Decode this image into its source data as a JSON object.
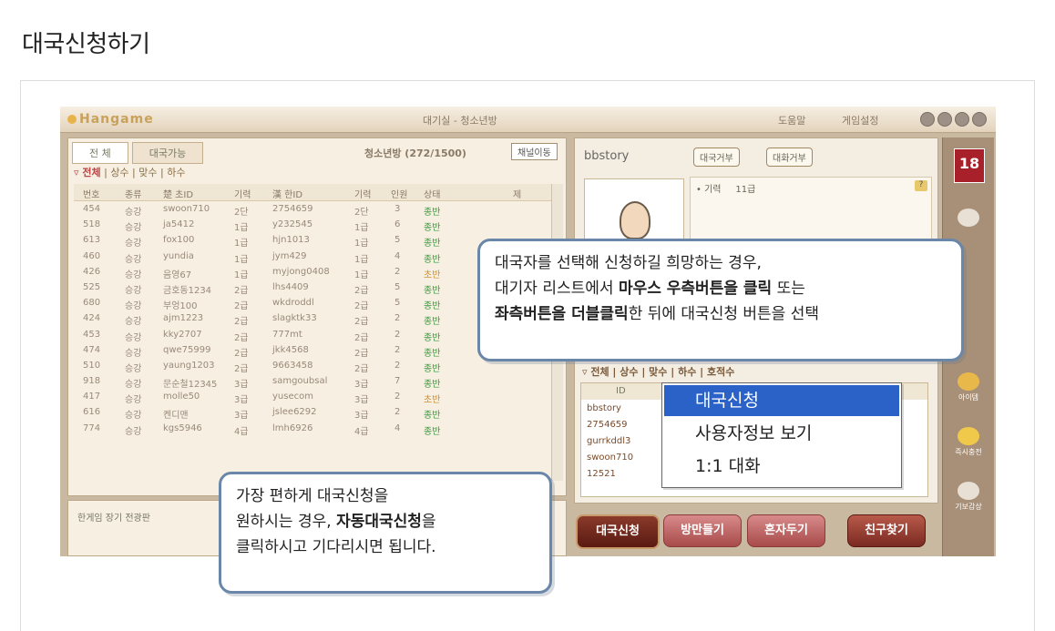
{
  "page": {
    "title": "대국신청하기"
  },
  "game": {
    "logo": "Hangame",
    "window_title": "대기실 - 청소년방",
    "help": "도움말",
    "settings": "게임설정",
    "tabs": [
      "전 체",
      "대국가능"
    ],
    "lobby_label": "청소년방 (272/1500)",
    "channel_button": "채널이동",
    "filters": {
      "all": "전체",
      "items": [
        "상수",
        "맞수",
        "하수"
      ]
    },
    "table_headers": [
      "번호",
      "종류",
      "楚 초ID",
      "기력",
      "漢 한ID",
      "기력",
      "인원",
      "상태",
      "제"
    ],
    "rooms": [
      [
        "454",
        "승강",
        "swoon710",
        "2단",
        "2754659",
        "2단",
        "3",
        "종반"
      ],
      [
        "518",
        "승강",
        "ja5412",
        "1급",
        "y232545",
        "1급",
        "6",
        "종반"
      ],
      [
        "613",
        "승강",
        "fox100",
        "1급",
        "hjn1013",
        "1급",
        "5",
        "종반"
      ],
      [
        "460",
        "승강",
        "yundia",
        "1급",
        "jym429",
        "1급",
        "4",
        "종반"
      ],
      [
        "426",
        "승강",
        "음영67",
        "1급",
        "myjong0408",
        "1급",
        "2",
        "초반"
      ],
      [
        "525",
        "승강",
        "금호동1234",
        "2급",
        "lhs4409",
        "2급",
        "5",
        "종반"
      ],
      [
        "680",
        "승강",
        "부엉100",
        "2급",
        "wkdroddl",
        "2급",
        "5",
        "종반"
      ],
      [
        "424",
        "승강",
        "ajm1223",
        "2급",
        "slagktk33",
        "2급",
        "2",
        "종반"
      ],
      [
        "453",
        "승강",
        "kky2707",
        "2급",
        "777mt",
        "2급",
        "2",
        "종반"
      ],
      [
        "474",
        "승강",
        "qwe75999",
        "2급",
        "jkk4568",
        "2급",
        "2",
        "종반"
      ],
      [
        "510",
        "승강",
        "yaung1203",
        "2급",
        "9663458",
        "2급",
        "2",
        "종반"
      ],
      [
        "918",
        "승강",
        "문순철12345",
        "3급",
        "samgoubsal",
        "3급",
        "7",
        "종반"
      ],
      [
        "417",
        "승강",
        "molle50",
        "3급",
        "yusecom",
        "3급",
        "2",
        "초반"
      ],
      [
        "616",
        "승강",
        "켄디맨",
        "3급",
        "jslee6292",
        "3급",
        "2",
        "종반"
      ],
      [
        "774",
        "승강",
        "kgs5946",
        "4급",
        "lmh6926",
        "4급",
        "4",
        "종반"
      ]
    ],
    "chat_label": "한게임 장기 전광판",
    "user": {
      "name": "bbstory",
      "refuse_match": "대국거부",
      "refuse_chat": "대화거부",
      "record_label": "• 기력",
      "grade": "11급"
    },
    "user_filters": "▿ 전체 | 상수 | 맞수 | 하수 | 호적수",
    "user_list_header": "ID",
    "users": [
      "bbstory",
      "2754659",
      "gurrkddl3",
      "swoon710",
      "12521"
    ],
    "context_menu": [
      "대국신청",
      "사용자정보 보기",
      "1:1 대화"
    ],
    "bottom_buttons": [
      "대국신청",
      "방만들기",
      "혼자두기",
      "친구찾기"
    ],
    "sidebar": {
      "age": "18",
      "items": [
        "",
        "",
        "아이템",
        "즉시충전",
        "기보감상"
      ]
    }
  },
  "callouts": {
    "top": {
      "line1": "대국자를 선택해 신청하길 희망하는 경우,",
      "line2_a": "대기자 리스트에서 ",
      "line2_b": "마우스 우측버튼을 클릭",
      "line2_c": " 또는",
      "line3_a": "좌측버튼을 더블클릭",
      "line3_b": "한 뒤에 대국신청 버튼을 선택"
    },
    "bottom": {
      "line1": "가장 편하게 대국신청을",
      "line2_a": "원하시는 경우, ",
      "line2_b": "자동대국신청",
      "line2_c": "을",
      "line3": "클릭하시고 기다리시면 됩니다."
    }
  }
}
